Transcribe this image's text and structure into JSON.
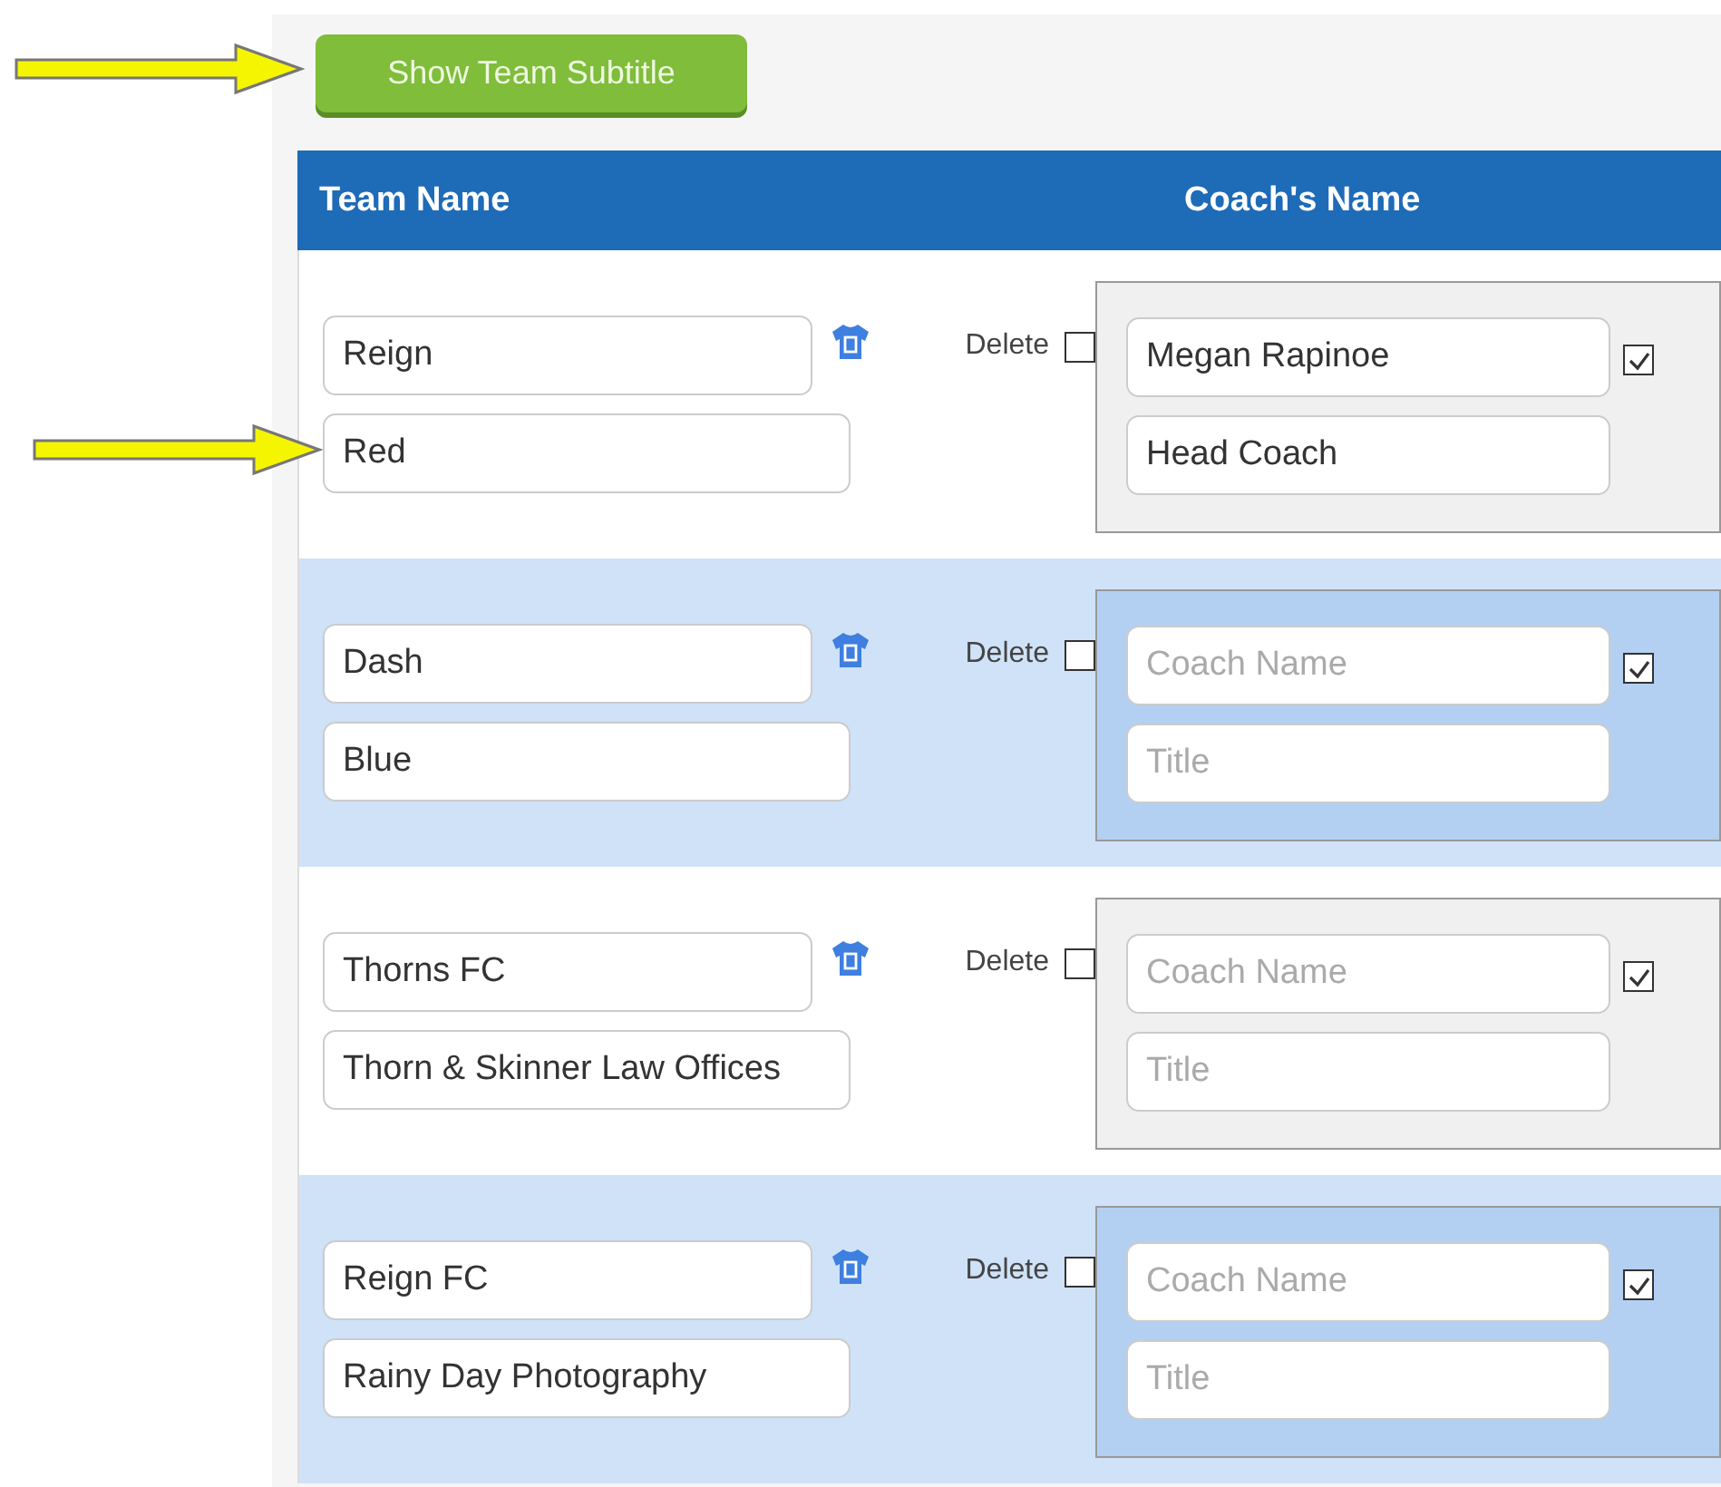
{
  "show_subtitle_button": "Show Team Subtitle",
  "columns": [
    "Team Name",
    "Coach's Name"
  ],
  "teams": [
    {
      "name": "Reign",
      "subtitle": "Red",
      "delete_label": "Delete",
      "delete_checked": false,
      "coach": {
        "name": "Megan Rapinoe",
        "title": "Head Coach",
        "checked": true
      }
    },
    {
      "name": "Dash",
      "subtitle": "Blue",
      "delete_label": "Delete",
      "delete_checked": false,
      "coach": {
        "name_placeholder": "Coach Name",
        "title_placeholder": "Title",
        "checked": true
      }
    },
    {
      "name": "Thorns FC",
      "subtitle": "Thorn & Skinner Law Offices",
      "delete_label": "Delete",
      "delete_checked": false,
      "coach": {
        "name_placeholder": "Coach Name",
        "title_placeholder": "Title",
        "checked": true
      }
    },
    {
      "name": "Reign FC",
      "subtitle": "Rainy Day Photography",
      "delete_label": "Delete",
      "delete_checked": false,
      "coach": {
        "name_placeholder": "Coach Name",
        "title_placeholder": "Title",
        "checked": true
      }
    }
  ]
}
